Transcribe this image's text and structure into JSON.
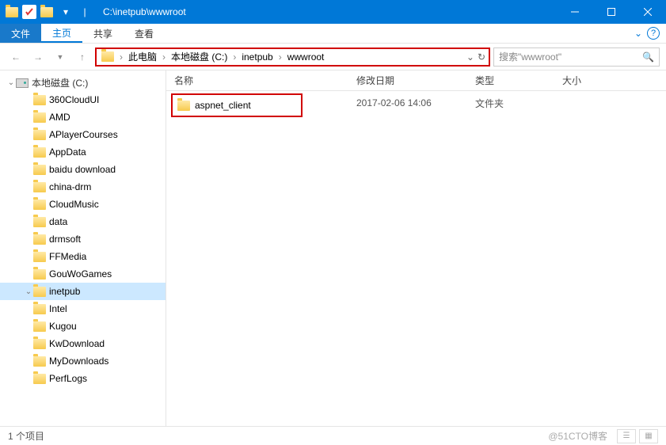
{
  "title": "C:\\inetpub\\wwwroot",
  "ribbon": {
    "file": "文件",
    "tabs": [
      "主页",
      "共享",
      "查看"
    ]
  },
  "breadcrumb": [
    "此电脑",
    "本地磁盘 (C:)",
    "inetpub",
    "wwwroot"
  ],
  "search_placeholder": "搜索\"wwwroot\"",
  "tree_root": "本地磁盘 (C:)",
  "tree": [
    {
      "n": "360CloudUI"
    },
    {
      "n": "AMD"
    },
    {
      "n": "APlayerCourses"
    },
    {
      "n": "AppData"
    },
    {
      "n": "baidu download"
    },
    {
      "n": "china-drm"
    },
    {
      "n": "CloudMusic"
    },
    {
      "n": "data"
    },
    {
      "n": "drmsoft"
    },
    {
      "n": "FFMedia"
    },
    {
      "n": "GouWoGames"
    },
    {
      "n": "inetpub",
      "sel": true,
      "exp": true
    },
    {
      "n": "Intel"
    },
    {
      "n": "Kugou"
    },
    {
      "n": "KwDownload"
    },
    {
      "n": "MyDownloads"
    },
    {
      "n": "PerfLogs"
    }
  ],
  "columns": {
    "name": "名称",
    "date": "修改日期",
    "type": "类型",
    "size": "大小"
  },
  "items": [
    {
      "name": "aspnet_client",
      "date": "2017-02-06 14:06",
      "type": "文件夹",
      "size": ""
    }
  ],
  "status": "1 个项目",
  "watermark": "@51CTO博客"
}
